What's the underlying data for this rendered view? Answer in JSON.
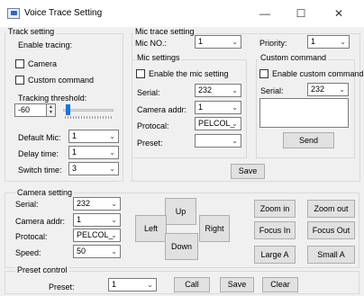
{
  "window": {
    "title": "Voice Trace Setting",
    "minimize_icon": "—",
    "maximize_icon": "☐",
    "close_icon": "✕"
  },
  "track_setting": {
    "legend": "Track setting",
    "enable_tracing_label": "Enable tracing:",
    "camera_label": "Camera",
    "custom_command_label": "Custom command",
    "tracking_threshold_label": "Tracking threshold:",
    "threshold_value": "-60",
    "threshold_slider_level": 0.05,
    "default_mic_label": "Default Mic:",
    "default_mic_value": "1",
    "delay_time_label": "Delay time:",
    "delay_time_value": "1",
    "switch_time_label": "Switch time:",
    "switch_time_value": "3"
  },
  "mic_trace": {
    "legend": "Mic trace setting",
    "mic_no_label": "Mic NO.:",
    "mic_no_value": "1",
    "priority_label": "Priority:",
    "priority_value": "1",
    "mic_settings": {
      "legend": "Mic settings",
      "enable_label": "Enable the mic setting",
      "serial_label": "Serial:",
      "serial_value": "232",
      "camera_addr_label": "Camera addr:",
      "camera_addr_value": "1",
      "protocal_label": "Protocal:",
      "protocal_value": "PELCOL_",
      "preset_label": "Preset:",
      "preset_value": ""
    },
    "custom_command": {
      "legend": "Custom command",
      "enable_label": "Enable custom command",
      "serial_label": "Serial:",
      "serial_value": "232",
      "send_label": "Send"
    },
    "save_label": "Save"
  },
  "camera_setting": {
    "legend": "Camera setting",
    "serial_label": "Serial:",
    "serial_value": "232",
    "camera_addr_label": "Camera addr:",
    "camera_addr_value": "1",
    "protocal_label": "Protocal:",
    "protocal_value": "PELCOL_",
    "speed_label": "Speed:",
    "speed_value": "50",
    "up_label": "Up",
    "down_label": "Down",
    "left_label": "Left",
    "right_label": "Right",
    "zoom_in_label": "Zoom in",
    "zoom_out_label": "Zoom out",
    "focus_in_label": "Focus In",
    "focus_out_label": "Focus Out",
    "large_a_label": "Large A",
    "small_a_label": "Small A"
  },
  "preset_control": {
    "legend": "Preset control",
    "preset_label": "Preset:",
    "preset_value": "1",
    "call_label": "Call",
    "save_label": "Save",
    "clear_label": "Clear"
  },
  "icons": {
    "chevron": "⌄",
    "spin_up": "▲",
    "spin_down": "▼"
  }
}
